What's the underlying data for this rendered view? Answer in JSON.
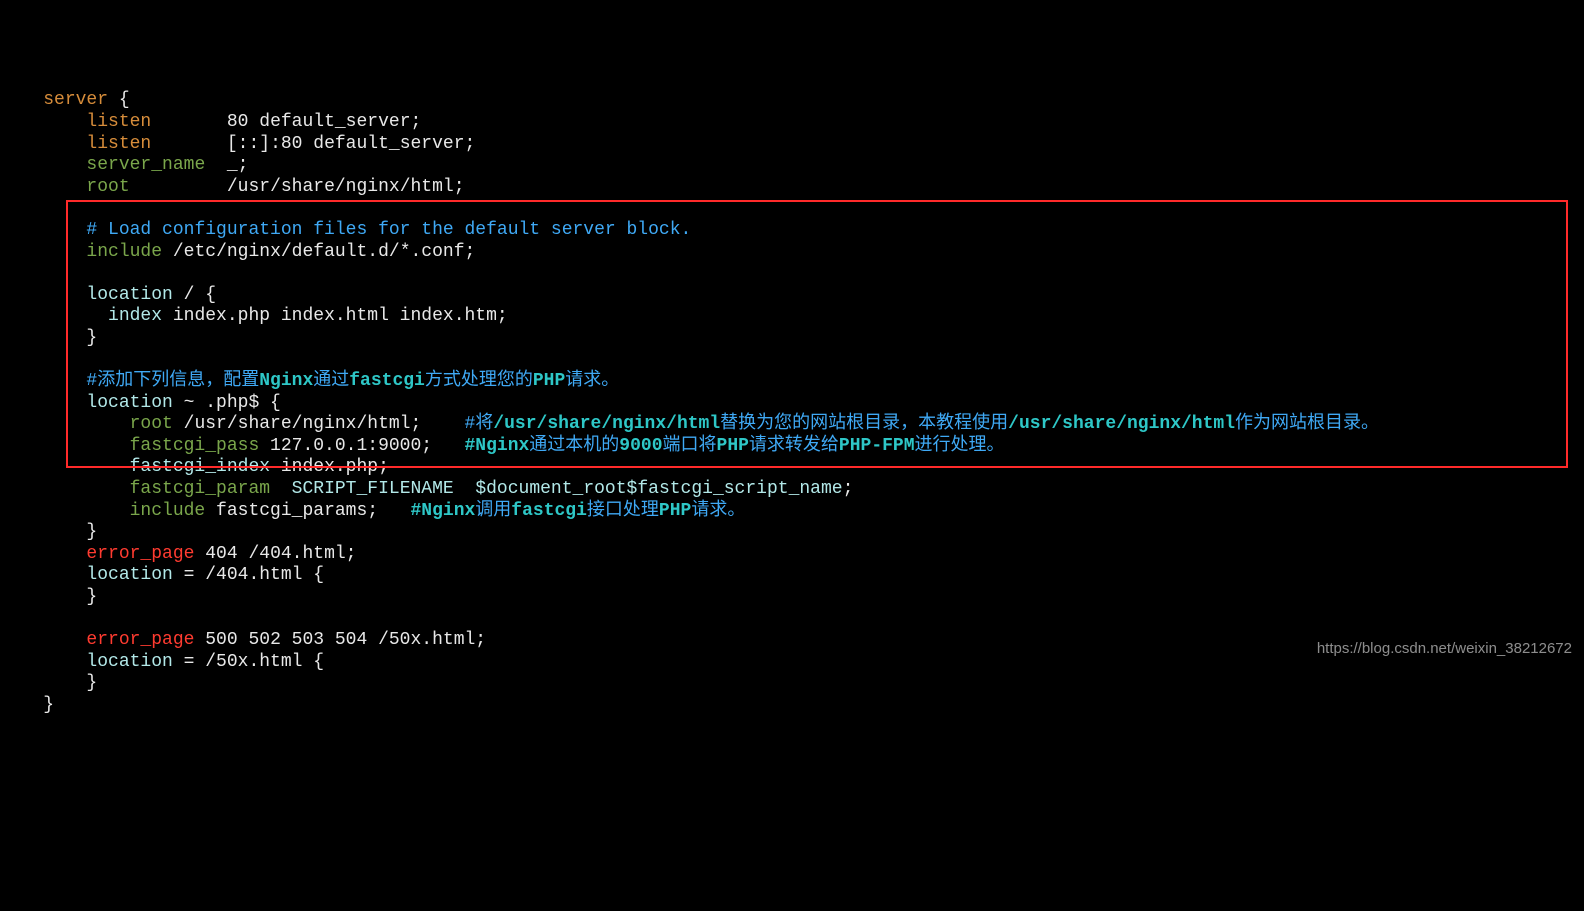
{
  "watermark": "https://blog.csdn.net/weixin_38212672",
  "config": {
    "l1_server": "server",
    "l1_brace": " {",
    "l2_listen": "listen",
    "l2_val": "80 default_server;",
    "l3_listen": "listen",
    "l3_val": "[::]:80 default_server;",
    "l4_servername": "server_name",
    "l4_val": "_;",
    "l5_root": "root",
    "l5_val": "/usr/share/nginx/html;",
    "l6_comment": "# Load configuration files for the default server block.",
    "l7_include": "include",
    "l7_val": "/etc/nginx/default.d/*.conf;",
    "l8_location": "location",
    "l8_rest": " / {",
    "l9_index": "index",
    "l9_val": " index.php index.html index.htm;",
    "l10_brace": "}",
    "l11_comment_a": "#添加下列信息，配置",
    "l11_nginx": "Nginx",
    "l11_comment_b": "通过",
    "l11_fastcgi": "fastcgi",
    "l11_comment_c": "方式处理您的",
    "l11_php": "PHP",
    "l11_comment_d": "请求。",
    "l12_location": "location",
    "l12_rest": " ~ .php$ {",
    "l13_root": "root",
    "l13_val": " /usr/share/nginx/html;",
    "l13_c_a": "#将",
    "l13_c_b": "/usr/share/nginx/html",
    "l13_c_c": "替换为您的网站根目录，本教程使用",
    "l13_c_d": "/usr/share/nginx/html",
    "l13_c_e": "作为网站根目录。",
    "l14_fp": "fastcgi_pass",
    "l14_val": " 127.0.0.1:9000;",
    "l14_c_a": "#Nginx",
    "l14_c_b": "通过本机的",
    "l14_c_c": "9000",
    "l14_c_d": "端口将",
    "l14_c_e": "PHP",
    "l14_c_f": "请求转发给",
    "l14_c_g": "PHP-FPM",
    "l14_c_h": "进行处理。",
    "l15_fi": "fastcgi_index",
    "l15_val": " index.php;",
    "l16_fp": "fastcgi_param",
    "l16_sf": "SCRIPT_FILENAME",
    "l16_dr": "$document_root$fastcgi_script_name",
    "l16_semi": ";",
    "l17_inc": "include",
    "l17_val": " fastcgi_params;",
    "l17_c_a": "#Nginx",
    "l17_c_b": "调用",
    "l17_c_c": "fastcgi",
    "l17_c_d": "接口处理",
    "l17_c_e": "PHP",
    "l17_c_f": "请求。",
    "l18_brace": "}",
    "l19_ep": "error_page",
    "l19_val": " 404 /404.html;",
    "l20_loc": "location",
    "l20_rest": " = /404.html {",
    "l21_brace": "}",
    "l22_ep": "error_page",
    "l22_val": " 500 502 503 504 /50x.html;",
    "l23_loc": "location",
    "l23_rest": " = /50x.html {",
    "l24_brace": "}",
    "l25_brace": "}"
  }
}
